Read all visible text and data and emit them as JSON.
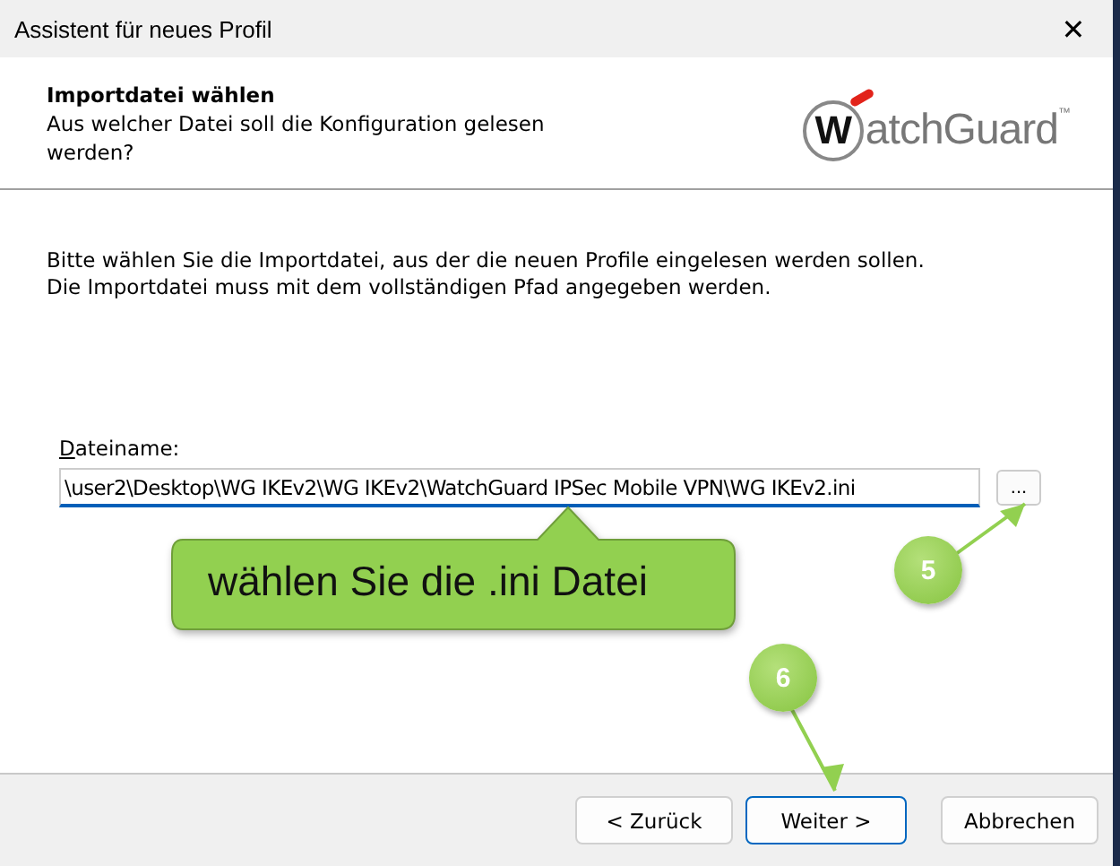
{
  "window": {
    "title": "Assistent für neues Profil",
    "close": "✕"
  },
  "header": {
    "title": "Importdatei wählen",
    "subtitle": "Aus welcher Datei soll die Konfiguration gelesen werden?",
    "logo": {
      "initial": "W",
      "rest": "atchGuard",
      "mark": "™"
    }
  },
  "instructions": [
    "Bitte wählen Sie die Importdatei, aus der die neuen Profile eingelesen werden sollen.",
    "Die Importdatei muss mit dem vollständigen Pfad angegeben werden."
  ],
  "file_field": {
    "label": "Dateiname:",
    "value": "\\user2\\Desktop\\WG IKEv2\\WG IKEv2\\WatchGuard IPSec Mobile VPN\\WG IKEv2.ini",
    "focused": true,
    "browse": "..."
  },
  "callouts": [
    {
      "kind": "bubble",
      "text": "wählen Sie die .ini Datei"
    },
    {
      "kind": "step",
      "text": "5"
    },
    {
      "kind": "step",
      "text": "6"
    }
  ],
  "buttons": [
    {
      "label": "< Zurück",
      "default": false
    },
    {
      "label": "Weiter >",
      "default": true
    },
    {
      "label": "Abbrechen",
      "default": false
    }
  ]
}
